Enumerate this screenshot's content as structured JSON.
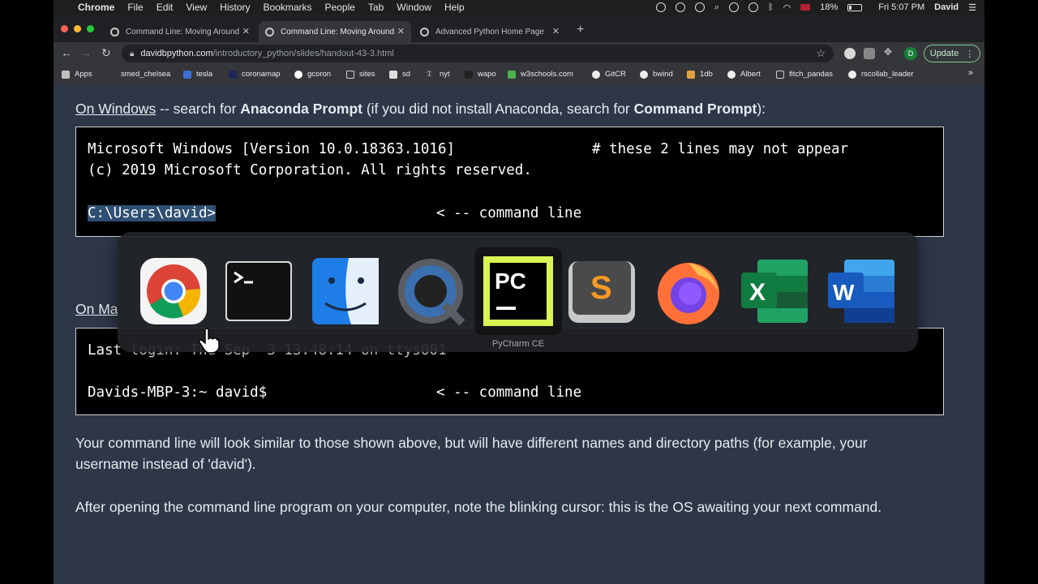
{
  "menubar": {
    "app": "Chrome",
    "items": [
      "File",
      "Edit",
      "View",
      "History",
      "Bookmarks",
      "People",
      "Tab",
      "Window",
      "Help"
    ],
    "battery": "18%",
    "clock": "Fri 5:07 PM",
    "user": "David"
  },
  "tabs": [
    {
      "title": "Command Line: Moving Around",
      "active": false
    },
    {
      "title": "Command Line: Moving Around",
      "active": true
    },
    {
      "title": "Advanced Python Home Page",
      "active": false
    }
  ],
  "toolbar": {
    "url_host": "davidbpython.com",
    "url_path": "/introductory_python/slides/handout-43-3.html",
    "profile_initial": "D",
    "update_label": "Update"
  },
  "bookmarks": [
    "Apps",
    "smed_chelsea",
    "tesla",
    "coronamap",
    "gcoron",
    "sites",
    "sd",
    "nyt",
    "wapo",
    "w3schools.com",
    "GitCR",
    "bwind",
    "1db",
    "Albert",
    "fitch_pandas",
    "rscollab_leader"
  ],
  "content": {
    "windows_intro": {
      "link": "On Windows",
      "text1": " -- search for ",
      "bold1": "Anaconda Prompt",
      "text2": " (if you did not install Anaconda, search for ",
      "bold2": "Command Prompt",
      "text3": "):"
    },
    "windows_code": {
      "line1": "Microsoft Windows [Version 10.0.18363.1016]",
      "comment": "# these 2 lines may not appear",
      "line2": "(c) 2019 Microsoft Corporation. All rights reserved.",
      "prompt": "C:\\Users\\david>",
      "annotation": "< -- command line"
    },
    "mac_intro": {
      "link": "On Ma"
    },
    "mac_code": {
      "line1": "Last login: Thu Sep  3 13:48:14 on ttys001",
      "prompt": "Davids-MBP-3:~ david$",
      "annotation": "< -- command line"
    },
    "para1_line1": "Your command line will look similar to those shown above, but will have different names and directory paths (for example, your",
    "para1_line2": "username instead of 'david').",
    "para2": "After opening the command line program on your computer, note the blinking cursor:  this is the OS awaiting your next command."
  },
  "switcher": {
    "apps": [
      "Google Chrome",
      "Terminal",
      "Finder",
      "QuickTime Player",
      "PyCharm CE",
      "Sublime Text",
      "Firefox",
      "Microsoft Excel",
      "Microsoft Word"
    ],
    "selected_label": "PyCharm CE"
  }
}
